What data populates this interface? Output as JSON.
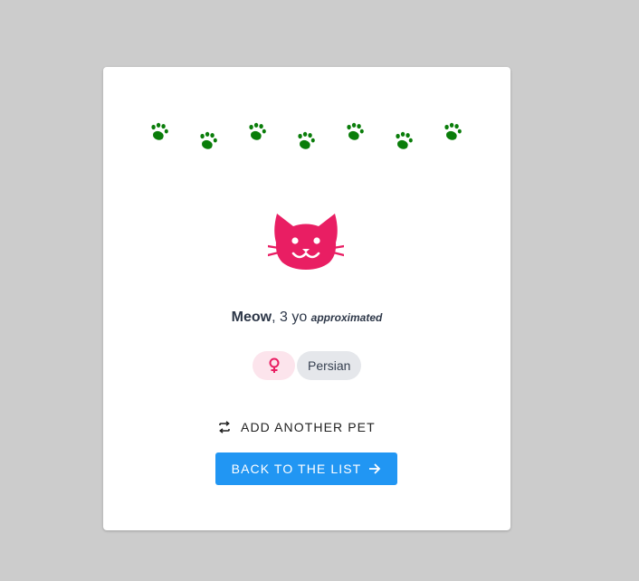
{
  "colors": {
    "background": "#cccccc",
    "card": "#ffffff",
    "paw": "#0a7d0a",
    "cat": "#e91e63",
    "gender_chip_bg": "#fce4ec",
    "breed_chip_bg": "#e5e7eb",
    "primary_button": "#2196f3"
  },
  "paws": [
    "paw-icon",
    "paw-icon",
    "paw-icon",
    "paw-icon",
    "paw-icon",
    "paw-icon",
    "paw-icon"
  ],
  "pet": {
    "icon": "cat-icon",
    "name": "Meow",
    "age_text": ", 3 yo ",
    "age_note": "approximated",
    "gender_icon": "female-icon",
    "breed": "Persian"
  },
  "actions": {
    "add_another": "ADD ANOTHER PET",
    "add_icon": "repeat-icon",
    "back_to_list": "BACK TO THE LIST",
    "back_icon": "arrow-right-icon"
  }
}
